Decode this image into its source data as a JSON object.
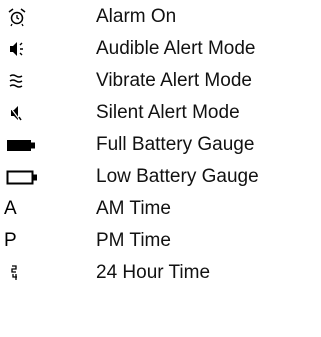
{
  "legend": {
    "items": [
      {
        "icon": "alarm-clock-icon",
        "label": "Alarm On"
      },
      {
        "icon": "speaker-sound-icon",
        "label": "Audible Alert Mode"
      },
      {
        "icon": "vibrate-icon",
        "label": "Vibrate Alert Mode"
      },
      {
        "icon": "speaker-mute-icon",
        "label": "Silent Alert Mode"
      },
      {
        "icon": "full-battery-icon",
        "label": "Full Battery Gauge"
      },
      {
        "icon": "low-battery-icon",
        "label": "Low Battery Gauge"
      },
      {
        "icon": "am-indicator",
        "icon_text": "A",
        "label": "AM Time"
      },
      {
        "icon": "pm-indicator",
        "icon_text": "P",
        "label": "PM Time"
      },
      {
        "icon": "24-hour-icon",
        "label": "24 Hour Time"
      }
    ]
  }
}
